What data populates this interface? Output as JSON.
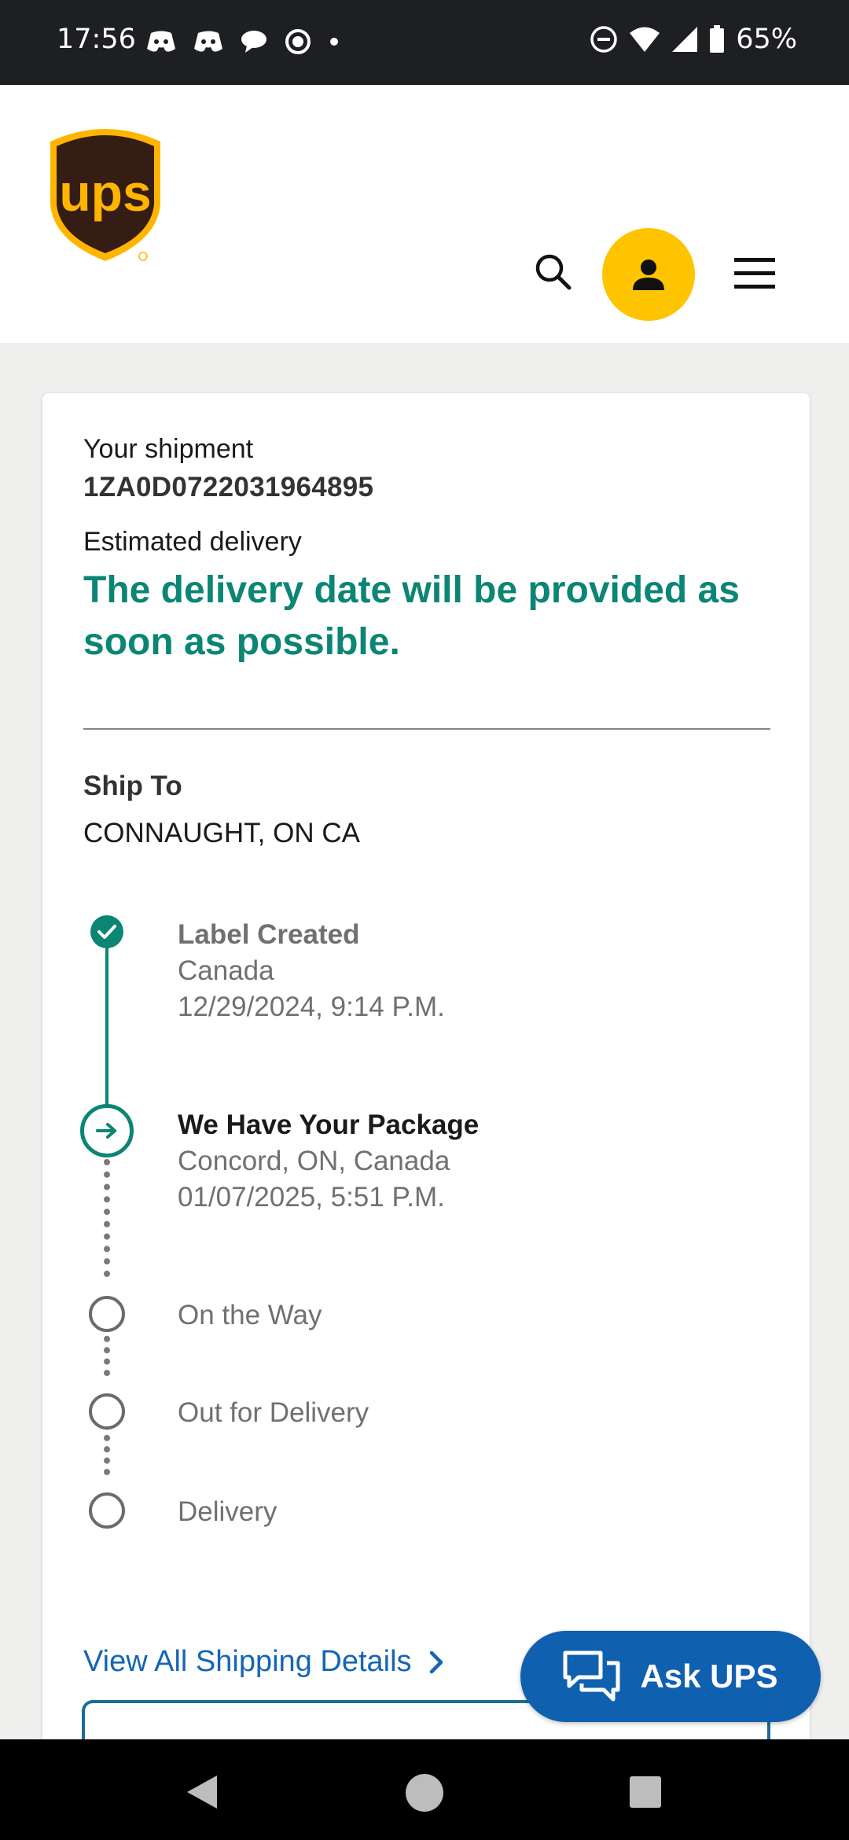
{
  "status_bar": {
    "time": "17:56",
    "battery": "65%",
    "icons_left": [
      "discord-icon",
      "discord-icon",
      "chat-bubble-icon",
      "signal-app-icon",
      "dot-icon"
    ],
    "icons_right": [
      "do-not-disturb-icon",
      "wifi-icon",
      "cell-signal-icon",
      "battery-icon"
    ]
  },
  "header": {
    "logo": "UPS",
    "icons": [
      "search-icon",
      "account-icon",
      "menu-icon"
    ],
    "brand_colors": {
      "brown": "#351c15",
      "gold": "#ffb500",
      "avatar_yellow": "#ffc400"
    }
  },
  "shipment": {
    "label": "Your shipment",
    "tracking_number": "1ZA0D0722031964895",
    "estimated_label": "Estimated delivery",
    "delivery_message": "The delivery date will be provided as soon as possible.",
    "ship_to_label": "Ship To",
    "ship_to_value": "CONNAUGHT, ON CA"
  },
  "timeline": {
    "events": [
      {
        "title": "Label Created",
        "location": "Canada",
        "datetime": "12/29/2024, 9:14 P.M.",
        "state": "done"
      },
      {
        "title": "We Have Your Package",
        "location": "Concord, ON, Canada",
        "datetime": "01/07/2025, 5:51 P.M.",
        "state": "current"
      },
      {
        "title": "On the Way",
        "state": "pending"
      },
      {
        "title": "Out for Delivery",
        "state": "pending"
      },
      {
        "title": "Delivery",
        "state": "pending"
      }
    ],
    "accent_color": "#0b8574"
  },
  "links": {
    "view_all": "View All Shipping Details"
  },
  "ask_ups": {
    "label": "Ask UPS",
    "color": "#1060b0"
  }
}
